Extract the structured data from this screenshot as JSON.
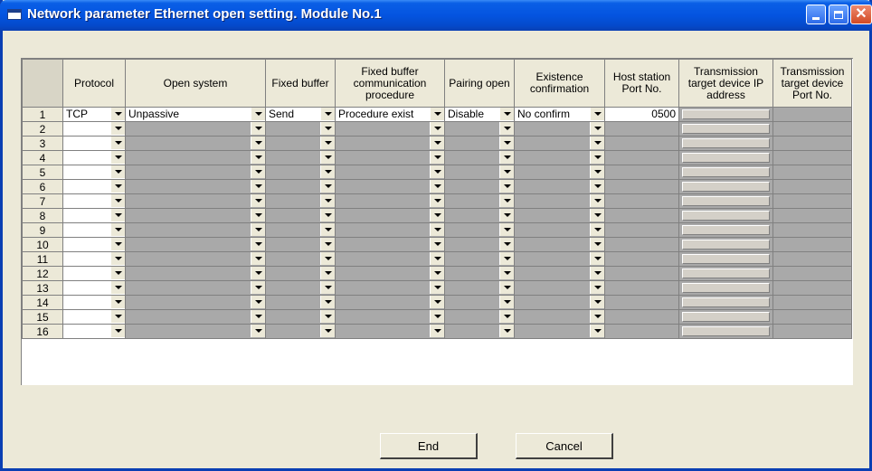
{
  "window": {
    "title": "Network parameter Ethernet open setting. Module No.1"
  },
  "table": {
    "headers": [
      "",
      "Protocol",
      "Open system",
      "Fixed buffer",
      "Fixed buffer communication procedure",
      "Pairing open",
      "Existence confirmation",
      "Host station Port No.",
      "Transmission target device IP address",
      "Transmission target device Port No."
    ],
    "rows": [
      {
        "num": "1",
        "protocol": "TCP",
        "open_system": "Unpassive",
        "fixed_buffer": "Send",
        "procedure": "Procedure exist",
        "pairing": "Disable",
        "existence": "No confirm",
        "host_port": "0500"
      },
      {
        "num": "2",
        "protocol": "",
        "open_system": "",
        "fixed_buffer": "",
        "procedure": "",
        "pairing": "",
        "existence": "",
        "host_port": ""
      },
      {
        "num": "3",
        "protocol": "",
        "open_system": "",
        "fixed_buffer": "",
        "procedure": "",
        "pairing": "",
        "existence": "",
        "host_port": ""
      },
      {
        "num": "4",
        "protocol": "",
        "open_system": "",
        "fixed_buffer": "",
        "procedure": "",
        "pairing": "",
        "existence": "",
        "host_port": ""
      },
      {
        "num": "5",
        "protocol": "",
        "open_system": "",
        "fixed_buffer": "",
        "procedure": "",
        "pairing": "",
        "existence": "",
        "host_port": ""
      },
      {
        "num": "6",
        "protocol": "",
        "open_system": "",
        "fixed_buffer": "",
        "procedure": "",
        "pairing": "",
        "existence": "",
        "host_port": ""
      },
      {
        "num": "7",
        "protocol": "",
        "open_system": "",
        "fixed_buffer": "",
        "procedure": "",
        "pairing": "",
        "existence": "",
        "host_port": ""
      },
      {
        "num": "8",
        "protocol": "",
        "open_system": "",
        "fixed_buffer": "",
        "procedure": "",
        "pairing": "",
        "existence": "",
        "host_port": ""
      },
      {
        "num": "9",
        "protocol": "",
        "open_system": "",
        "fixed_buffer": "",
        "procedure": "",
        "pairing": "",
        "existence": "",
        "host_port": ""
      },
      {
        "num": "10",
        "protocol": "",
        "open_system": "",
        "fixed_buffer": "",
        "procedure": "",
        "pairing": "",
        "existence": "",
        "host_port": ""
      },
      {
        "num": "11",
        "protocol": "",
        "open_system": "",
        "fixed_buffer": "",
        "procedure": "",
        "pairing": "",
        "existence": "",
        "host_port": ""
      },
      {
        "num": "12",
        "protocol": "",
        "open_system": "",
        "fixed_buffer": "",
        "procedure": "",
        "pairing": "",
        "existence": "",
        "host_port": ""
      },
      {
        "num": "13",
        "protocol": "",
        "open_system": "",
        "fixed_buffer": "",
        "procedure": "",
        "pairing": "",
        "existence": "",
        "host_port": ""
      },
      {
        "num": "14",
        "protocol": "",
        "open_system": "",
        "fixed_buffer": "",
        "procedure": "",
        "pairing": "",
        "existence": "",
        "host_port": ""
      },
      {
        "num": "15",
        "protocol": "",
        "open_system": "",
        "fixed_buffer": "",
        "procedure": "",
        "pairing": "",
        "existence": "",
        "host_port": ""
      },
      {
        "num": "16",
        "protocol": "",
        "open_system": "",
        "fixed_buffer": "",
        "procedure": "",
        "pairing": "",
        "existence": "",
        "host_port": ""
      }
    ]
  },
  "buttons": {
    "end": "End",
    "cancel": "Cancel"
  },
  "colors": {
    "titlebar": "#0454e0",
    "window_bg": "#ece9d8",
    "inactive_cell": "#a9a9a9",
    "active_cell": "#ffffff"
  }
}
